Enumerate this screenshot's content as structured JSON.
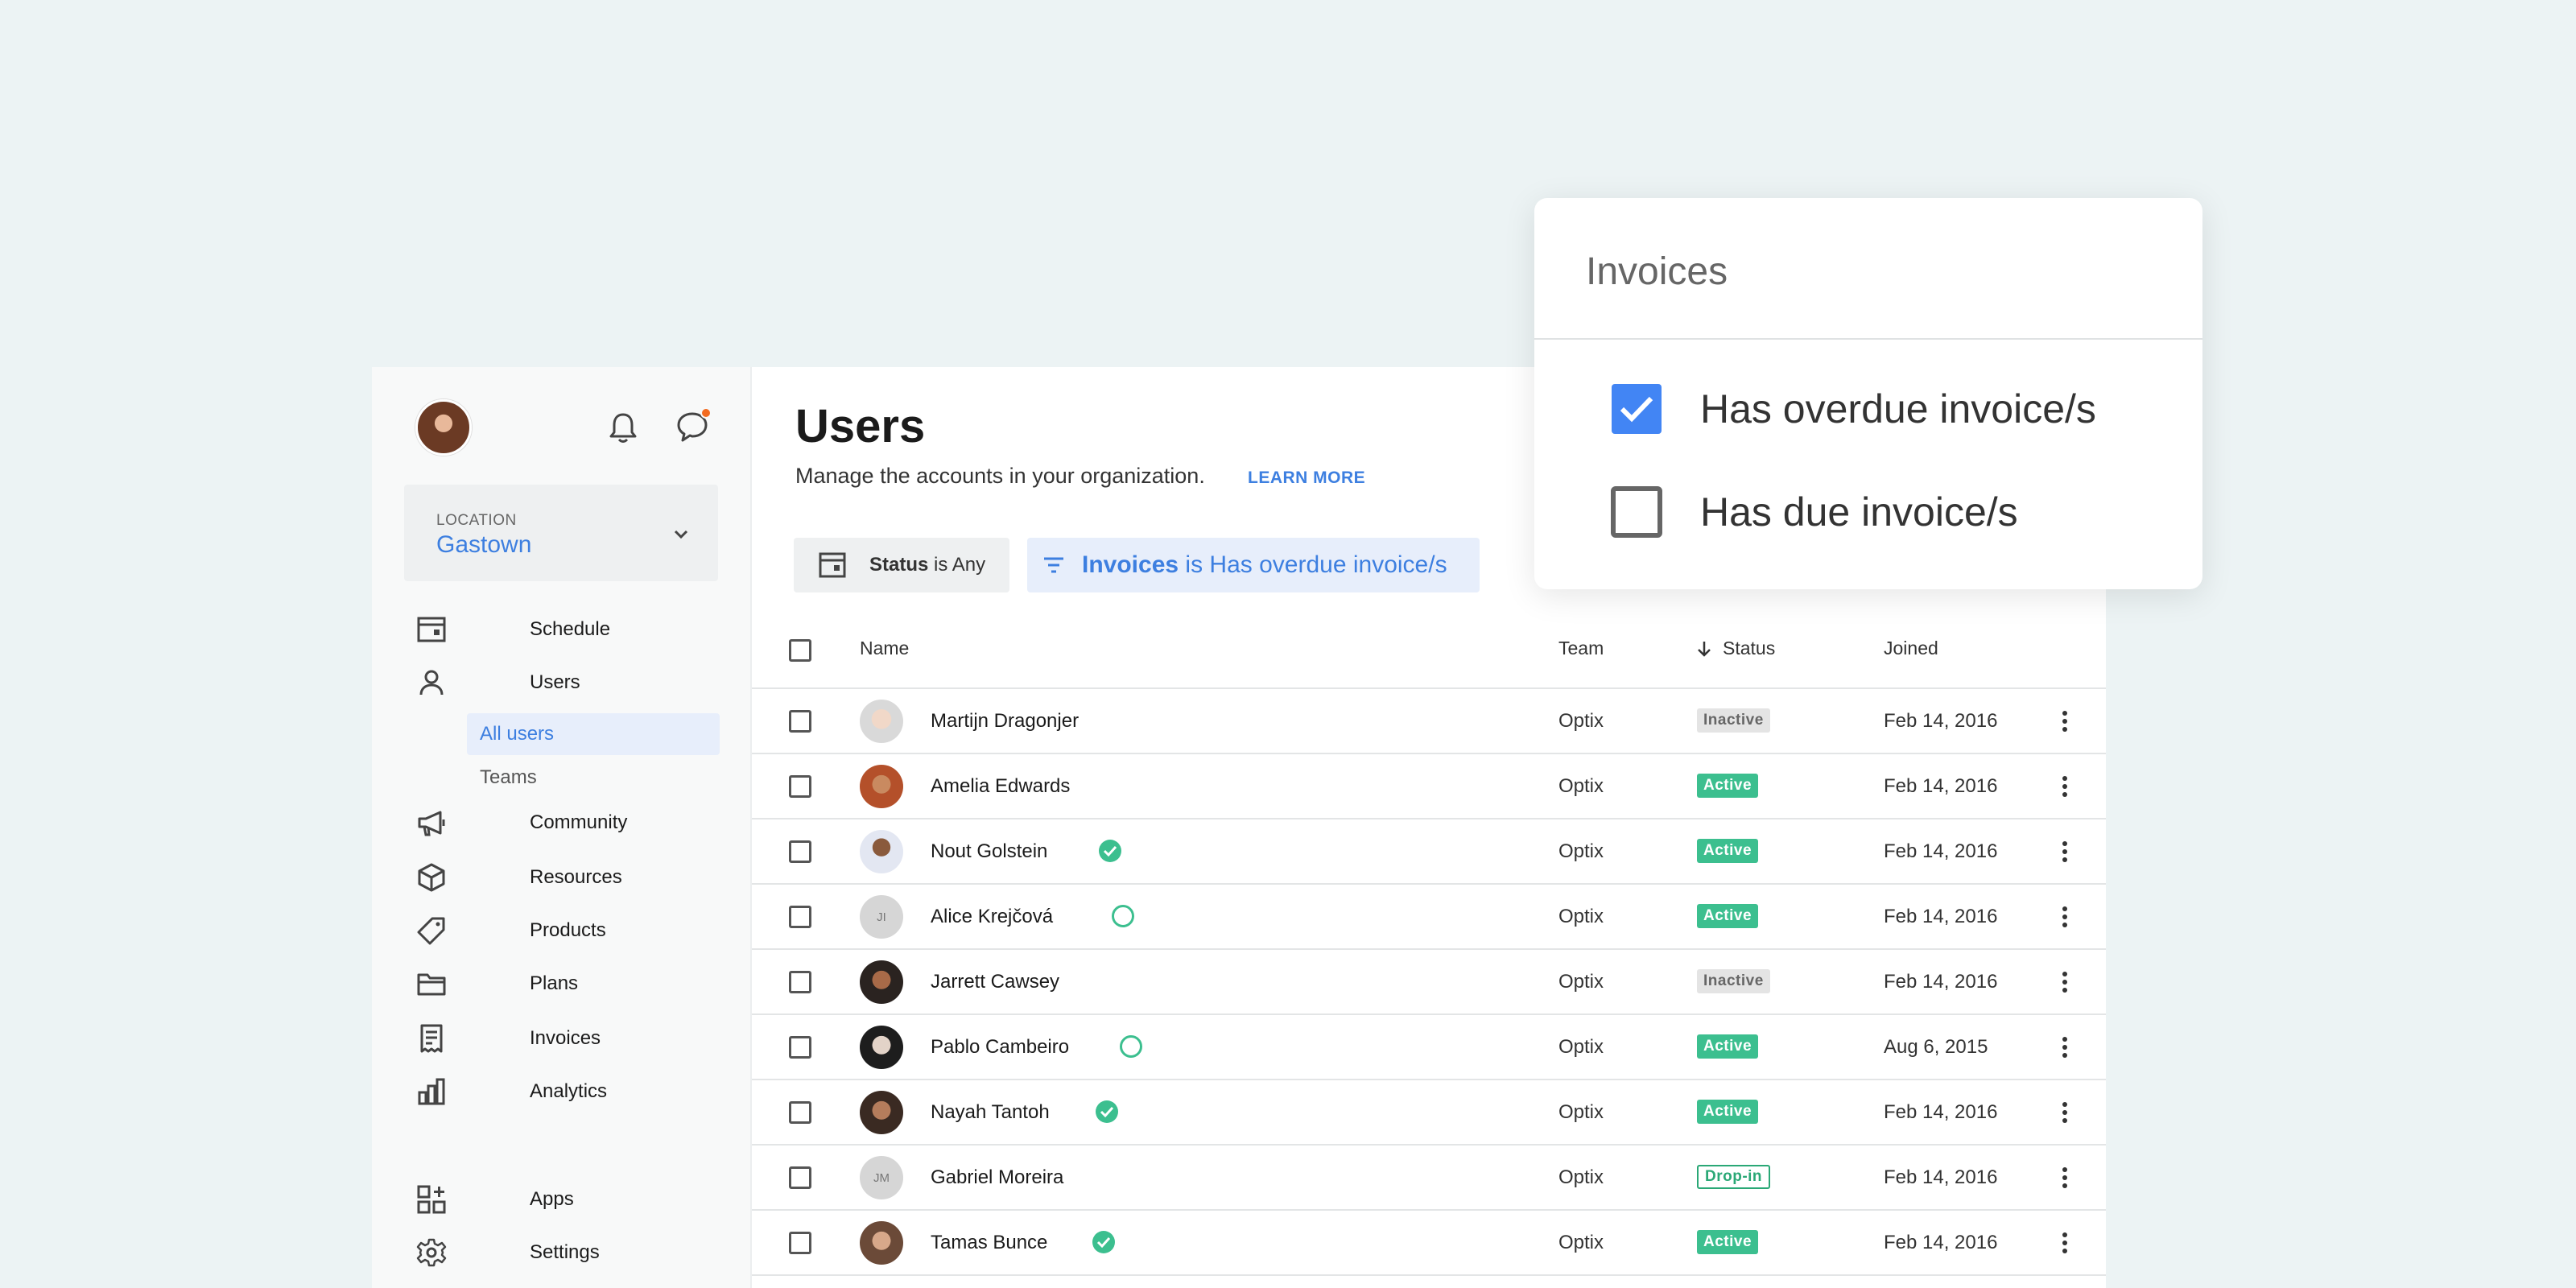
{
  "sidebar": {
    "location_label": "LOCATION",
    "location_value": "Gastown",
    "nav": {
      "schedule": "Schedule",
      "users": "Users",
      "all_users": "All users",
      "teams": "Teams",
      "community": "Community",
      "resources": "Resources",
      "products": "Products",
      "plans": "Plans",
      "invoices": "Invoices",
      "analytics": "Analytics",
      "apps": "Apps",
      "settings": "Settings"
    }
  },
  "main": {
    "title": "Users",
    "subtitle": "Manage the accounts in your organization.",
    "learn_more": "LEARN MORE",
    "filters": {
      "status_field": "Status",
      "status_op": "is",
      "status_value": "Any",
      "invoices_field": "Invoices",
      "invoices_op": "is",
      "invoices_value": "Has overdue invoice/s"
    },
    "columns": {
      "name": "Name",
      "team": "Team",
      "status": "Status",
      "joined": "Joined"
    },
    "rows": [
      {
        "name": "Martijn Dragonjer",
        "team": "Optix",
        "status": "Inactive",
        "joined": "Feb 14, 2016"
      },
      {
        "name": "Amelia Edwards",
        "team": "Optix",
        "status": "Active",
        "joined": "Feb 14, 2016"
      },
      {
        "name": "Nout Golstein",
        "team": "Optix",
        "status": "Active",
        "joined": "Feb 14, 2016"
      },
      {
        "name": "Alice Krejčová",
        "initials": "JI",
        "team": "Optix",
        "status": "Active",
        "joined": "Feb 14, 2016"
      },
      {
        "name": "Jarrett Cawsey",
        "team": "Optix",
        "status": "Inactive",
        "joined": "Feb 14, 2016"
      },
      {
        "name": "Pablo Cambeiro",
        "team": "Optix",
        "status": "Active",
        "joined": "Aug 6, 2015"
      },
      {
        "name": "Nayah Tantoh",
        "team": "Optix",
        "status": "Active",
        "joined": "Feb 14, 2016"
      },
      {
        "name": "Gabriel Moreira",
        "initials": "JM",
        "team": "Optix",
        "status": "Drop-in",
        "joined": "Feb 14, 2016"
      },
      {
        "name": "Tamas Bunce",
        "team": "Optix",
        "status": "Active",
        "joined": "Feb 14, 2016"
      }
    ]
  },
  "popover": {
    "title": "Invoices",
    "option_1": "Has overdue invoice/s",
    "option_1_checked": true,
    "option_2": "Has due invoice/s",
    "option_2_checked": false
  },
  "colors": {
    "accent": "#3d7fe0",
    "active": "#3cbf8f",
    "notification": "#f26b21"
  }
}
